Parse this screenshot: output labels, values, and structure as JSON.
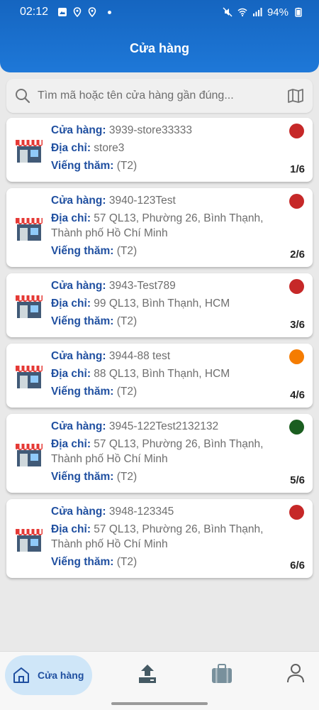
{
  "status_bar": {
    "time": "02:12",
    "battery": "94%"
  },
  "header": {
    "title": "Cửa hàng"
  },
  "search": {
    "placeholder": "Tìm mã hoặc tên cửa hàng gần đúng..."
  },
  "labels": {
    "store": "Cửa hàng:",
    "address": "Địa chỉ:",
    "visit": "Viếng thăm:"
  },
  "colors": {
    "red": "#c62828",
    "orange": "#f57c00",
    "green": "#1b5e20",
    "brand": "#1565c0"
  },
  "stores": [
    {
      "name": "3939-store33333",
      "address": "store3",
      "visit": "(T2)",
      "count": "1/6",
      "status": "red"
    },
    {
      "name": "3940-123Test",
      "address": "57 QL13, Phường 26, Bình Thạnh, Thành phố Hồ Chí Minh",
      "visit": "(T2)",
      "count": "2/6",
      "status": "red"
    },
    {
      "name": "3943-Test789",
      "address": "99 QL13, Bình Thạnh, HCM",
      "visit": "(T2)",
      "count": "3/6",
      "status": "red"
    },
    {
      "name": "3944-88 test",
      "address": "88 QL13, Bình Thạnh, HCM",
      "visit": "(T2)",
      "count": "4/6",
      "status": "orange"
    },
    {
      "name": "3945-122Test2132132",
      "address": "57 QL13, Phường 26, Bình Thạnh, Thành phố Hồ Chí Minh",
      "visit": "(T2)",
      "count": "5/6",
      "status": "green"
    },
    {
      "name": "3948-123345",
      "address": "57 QL13, Phường 26, Bình Thạnh, Thành phố Hồ Chí Minh",
      "visit": "(T2)",
      "count": "6/6",
      "status": "red"
    }
  ],
  "nav": {
    "home_label": "Cửa hàng",
    "icons": [
      "home-icon",
      "upload-icon",
      "briefcase-icon",
      "profile-icon"
    ]
  }
}
